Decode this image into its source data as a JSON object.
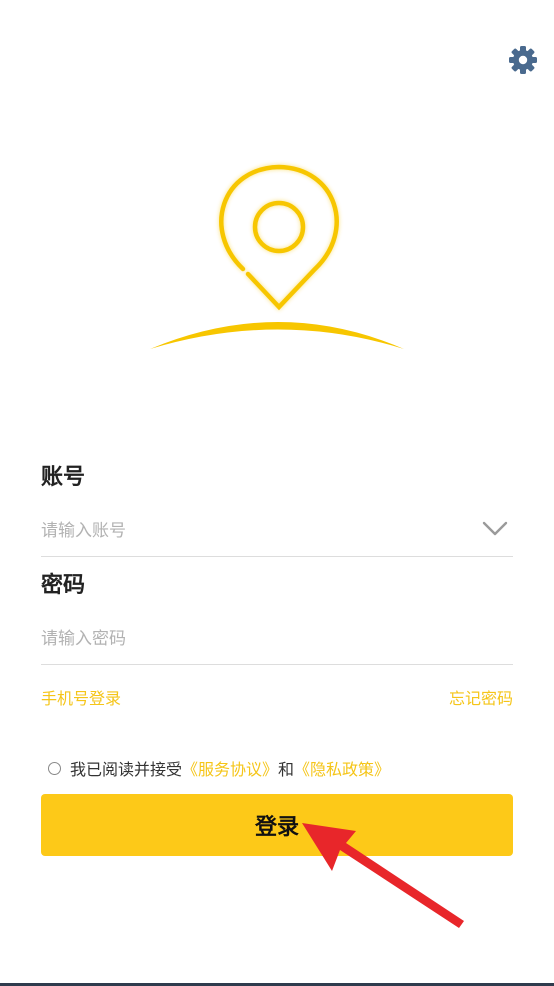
{
  "account": {
    "label": "账号",
    "placeholder": "请输入账号",
    "value": ""
  },
  "password": {
    "label": "密码",
    "placeholder": "请输入密码",
    "value": ""
  },
  "links": {
    "phone_login": "手机号登录",
    "forgot_password": "忘记密码"
  },
  "agreement": {
    "prefix": "我已阅读并接受",
    "service": "《服务协议》",
    "conjunction": "和",
    "privacy": "《隐私政策》"
  },
  "login_button": "登录",
  "icons": {
    "settings": "gear-icon",
    "logo": "location-pin-icon",
    "dropdown": "chevron-down-icon",
    "annotation": "red-arrow-icon"
  },
  "colors": {
    "accent": "#fdc918",
    "link": "#f5c518",
    "gear": "#4a6a8e",
    "annotation": "#e8262a"
  }
}
